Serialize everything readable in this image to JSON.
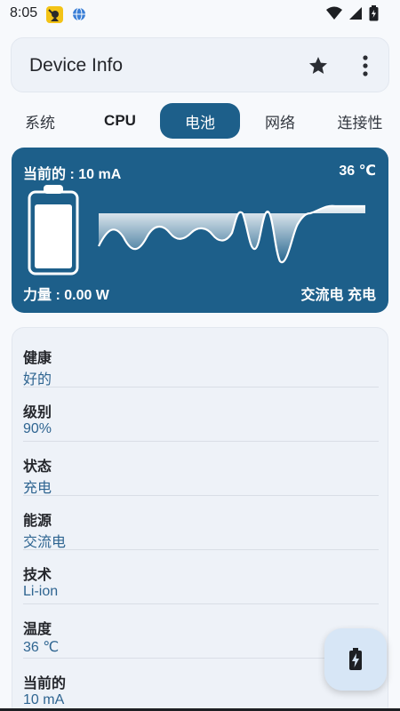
{
  "status_bar": {
    "time": "8:05",
    "icons": [
      "notification-app-icon",
      "globe-icon",
      "wifi-icon",
      "signal-icon",
      "battery-icon"
    ]
  },
  "app_bar": {
    "title": "Device Info",
    "actions": [
      "star-icon",
      "more-vert-icon"
    ]
  },
  "tabs": [
    {
      "label": "系统"
    },
    {
      "label": "CPU"
    },
    {
      "label": "电池",
      "selected": true
    },
    {
      "label": "网络"
    },
    {
      "label": "连接性"
    }
  ],
  "battery_card": {
    "current": "当前的 : 10 mA",
    "temperature": "36 ℃",
    "power": "力量 : 0.00 W",
    "charge_status": "交流电 充电",
    "level_percent": 90,
    "accent_color": "#1d5f8a"
  },
  "info_rows": [
    {
      "label": "健康",
      "value": "好的"
    },
    {
      "label": "级别",
      "value": "90%"
    },
    {
      "label": "状态",
      "value": "充电"
    },
    {
      "label": "能源",
      "value": "交流电"
    },
    {
      "label": "技术",
      "value": "Li-ion"
    },
    {
      "label": "温度",
      "value": "36 ℃"
    },
    {
      "label": "当前的",
      "value": "10 mA"
    }
  ],
  "fab": {
    "icon": "battery-charging-icon"
  }
}
